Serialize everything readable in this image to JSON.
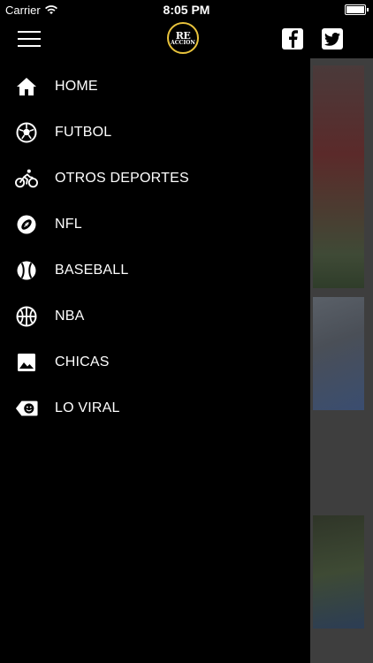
{
  "status_bar": {
    "carrier": "Carrier",
    "time": "8:05 PM"
  },
  "header": {
    "logo_line1": "RE",
    "logo_line2": "ACCION",
    "icons": [
      "hamburger-menu-icon",
      "facebook-icon",
      "twitter-icon"
    ]
  },
  "menu": {
    "items": [
      {
        "label": "HOME",
        "icon": "home-icon"
      },
      {
        "label": "FUTBOL",
        "icon": "soccer-ball-icon"
      },
      {
        "label": "OTROS DEPORTES",
        "icon": "bicycle-icon"
      },
      {
        "label": "NFL",
        "icon": "football-icon"
      },
      {
        "label": "BASEBALL",
        "icon": "baseball-icon"
      },
      {
        "label": "NBA",
        "icon": "basketball-icon"
      },
      {
        "label": "CHICAS",
        "icon": "image-icon"
      },
      {
        "label": "LO VIRAL",
        "icon": "smiley-tag-icon"
      }
    ]
  },
  "colors": {
    "background": "#000000",
    "logo_accent": "#e8c33c",
    "overlay": "#3e3e3e"
  }
}
